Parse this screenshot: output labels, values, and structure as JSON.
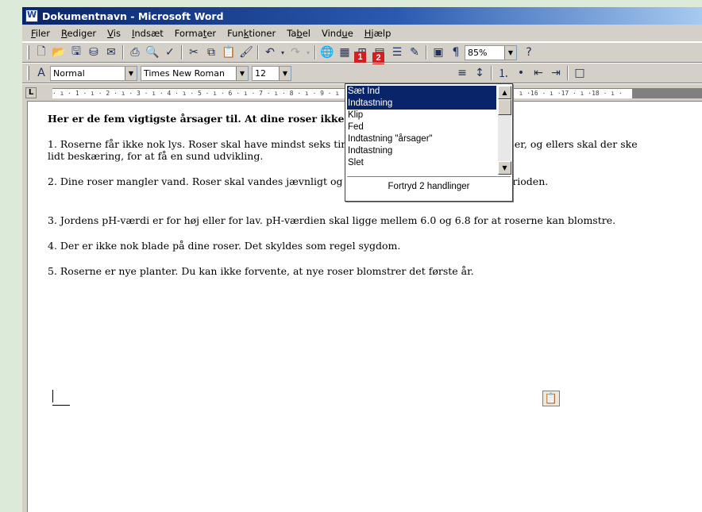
{
  "window": {
    "title": "Dokumentnavn - Microsoft Word",
    "background_color": "#dcebd9",
    "title_color": "#0a246a"
  },
  "menu": [
    {
      "key": "F",
      "rest": "iler"
    },
    {
      "key": "R",
      "rest": "ediger"
    },
    {
      "key": "V",
      "rest": "is"
    },
    {
      "key": "I",
      "rest": "ndsæt"
    },
    {
      "pre": "Forma",
      "key": "t",
      "rest": "er"
    },
    {
      "pre": "Fun",
      "key": "k",
      "rest": "tioner"
    },
    {
      "pre": "Ta",
      "key": "b",
      "rest": "el"
    },
    {
      "pre": "Vind",
      "key": "u",
      "rest": "e"
    },
    {
      "key": "H",
      "rest": "jælp"
    }
  ],
  "toolbar": {
    "icons": [
      "new-document-icon",
      "open-folder-icon",
      "save-icon",
      "permission-icon",
      "email-icon",
      "print-icon",
      "print-preview-icon",
      "spelling-icon",
      "cut-icon",
      "copy-icon",
      "paste-icon",
      "format-painter-icon",
      "undo-icon",
      "redo-icon",
      "hyperlink-icon",
      "tables-borders-icon",
      "insert-table-icon",
      "insert-excel-icon",
      "columns-icon",
      "drawing-icon",
      "document-map-icon",
      "show-formatting-icon"
    ],
    "zoom": "85%",
    "badges": [
      "1",
      "2"
    ]
  },
  "format_toolbar": {
    "style": "Normal",
    "font": "Times New Roman",
    "size": "12"
  },
  "ruler": {
    "text": "· ı · 1 · ı · 2 · ı · 3 · ı · 4 · ı · 5 · ı · 6 · ı · 7 · ı · 8 · ı · 9 · ı ·10 · ı ·11 · ı ·12 · ı ·13 · ı ·14 · ı ·15 · ı ·16 · ı ·17 · ı ·18 · ı ·"
  },
  "document": {
    "heading": "Her er de fem vigtigste årsager til. At dine roser ikke blomstrer:",
    "paragraphs": [
      "1. Roserne får ikke nok lys. Roser skal have mindst seks timers sollys om dagen, når de vokser, og ellers skal der ske lidt beskæring, for at få en sund udvikling.",
      "2. Dine roser mangler vand. Roser skal vandes jævnligt og helst en gang om ugen i vækstperioden.",
      "3. Jordens pH-værdi er for høj eller for lav. pH-værdien skal ligge mellem 6.0 og 6.8 for at roserne kan blomstre.",
      "4. Der er ikke nok blade på dine roser. Det skyldes som regel sygdom.",
      "5. Roserne er nye planter. Du kan ikke forvente, at nye roser blomstrer det første år."
    ]
  },
  "undo_dropdown": {
    "items": [
      "Sæt Ind",
      "Indtastning",
      "Klip",
      "Fed",
      "Indtastning \"årsager\"",
      "Indtastning",
      "Slet"
    ],
    "selected_count": 2,
    "status": "Fortryd 2 handlinger",
    "highlight_color": "#0a246a"
  }
}
